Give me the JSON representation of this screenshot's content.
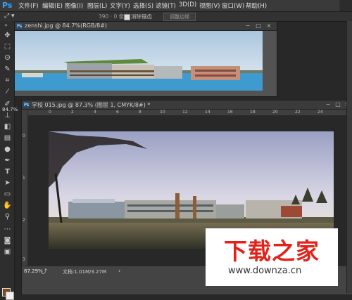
{
  "app": {
    "logo": "Ps"
  },
  "menu": {
    "items": [
      "文件(F)",
      "编辑(E)",
      "图像(I)",
      "图层(L)",
      "文字(Y)",
      "选择(S)",
      "滤镜(T)",
      "3D(D)",
      "视图(V)",
      "窗口(W)",
      "帮助(H)"
    ]
  },
  "options_bar": {
    "size_value": "390 · 0 像素",
    "antialias_label": "消除锯齿",
    "edge_button": "调整边缘"
  },
  "toolbox": {
    "zoom_readout": "84.7%",
    "foreground_color": "#7a4a20",
    "background_color": "#f0f0f0",
    "tools": [
      "move-icon",
      "marquee-icon",
      "lasso-icon",
      "quick-select-icon",
      "crop-icon",
      "eyedropper-icon",
      "brush-icon",
      "clone-icon",
      "eraser-icon",
      "gradient-icon",
      "dodge-icon",
      "pen-icon",
      "type-icon",
      "path-select-icon",
      "shape-icon",
      "hand-icon",
      "zoom-icon"
    ]
  },
  "documents": [
    {
      "title": "zenshi.jpg @ 84.7%(RGB/8#)",
      "buttons": [
        "−",
        "□",
        "×"
      ]
    },
    {
      "title": "学校 015.jpg @ 87.3% (图层 1, CMYK/8#) *",
      "buttons": [
        "−",
        "□",
        "×"
      ],
      "ruler_top": [
        "0",
        "2",
        "4",
        "6",
        "8",
        "10",
        "12",
        "14",
        "16",
        "18",
        "20",
        "22",
        "24"
      ],
      "ruler_left": [
        "0",
        "1",
        "2",
        "3"
      ],
      "status": {
        "zoom": "87.29%",
        "doc_info": "文档:1.01M/3.27M"
      }
    }
  ],
  "watermark": {
    "logo_text": "下载之家",
    "url": "www.downza.cn",
    "color": "#e1241b"
  }
}
